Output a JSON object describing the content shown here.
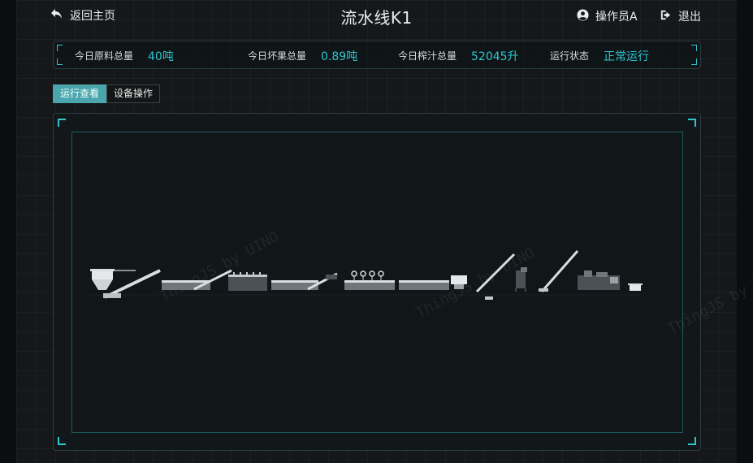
{
  "header": {
    "back_label": "返回主页",
    "title": "流水线K1",
    "user_label": "操作员A",
    "logout_label": "退出"
  },
  "stats": [
    {
      "label": "今日原料总量",
      "value": "40吨"
    },
    {
      "label": "今日坏果总量",
      "value": "0.89吨"
    },
    {
      "label": "今日榨汁总量",
      "value": "52045升"
    },
    {
      "label": "运行状态",
      "value": "正常运行"
    }
  ],
  "tabs": [
    {
      "label": "运行查看",
      "active": true
    },
    {
      "label": "设备操作",
      "active": false
    }
  ],
  "watermark": "ThingJS by UINO",
  "colors": {
    "accent": "#2ec6cf",
    "tab_active": "#4aa6ac",
    "machine_light": "#d9dde0",
    "machine_dark": "#4b5257"
  }
}
